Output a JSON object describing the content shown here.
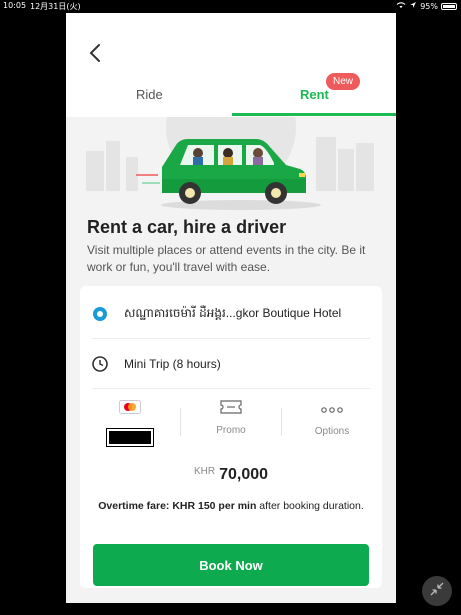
{
  "status_bar": {
    "time": "10:05",
    "date": "12月31日(火)",
    "battery": "95%"
  },
  "header": {
    "tabs": [
      {
        "label": "Ride",
        "active": false
      },
      {
        "label": "Rent",
        "active": true
      }
    ],
    "new_badge": "New"
  },
  "hero": {
    "illustration": "green-car-with-passengers-icon"
  },
  "content": {
    "headline": "Rent a car, hire a driver",
    "subtext": "Visit multiple places or attend events in the city. Be it work or fun, you'll travel with ease."
  },
  "booking": {
    "pickup": "សណ្ឋាគារចេម៉ារី ដឺអង្គរ...gkor Boutique Hotel",
    "package": "Mini Trip (8 hours)",
    "options": [
      {
        "label": "",
        "icon": "mastercard-icon"
      },
      {
        "label": "Promo",
        "icon": "promo-ticket-icon"
      },
      {
        "label": "Options",
        "icon": "more-dots-icon"
      }
    ],
    "price_currency": "KHR",
    "price_value": "70,000",
    "overtime_bold": "Overtime fare: KHR 150 per min",
    "overtime_rest": " after booking duration.",
    "cta": "Book Now"
  },
  "colors": {
    "brand_green": "#1db954",
    "button_green": "#0eaa4f",
    "badge_red": "#ef5a5a"
  }
}
